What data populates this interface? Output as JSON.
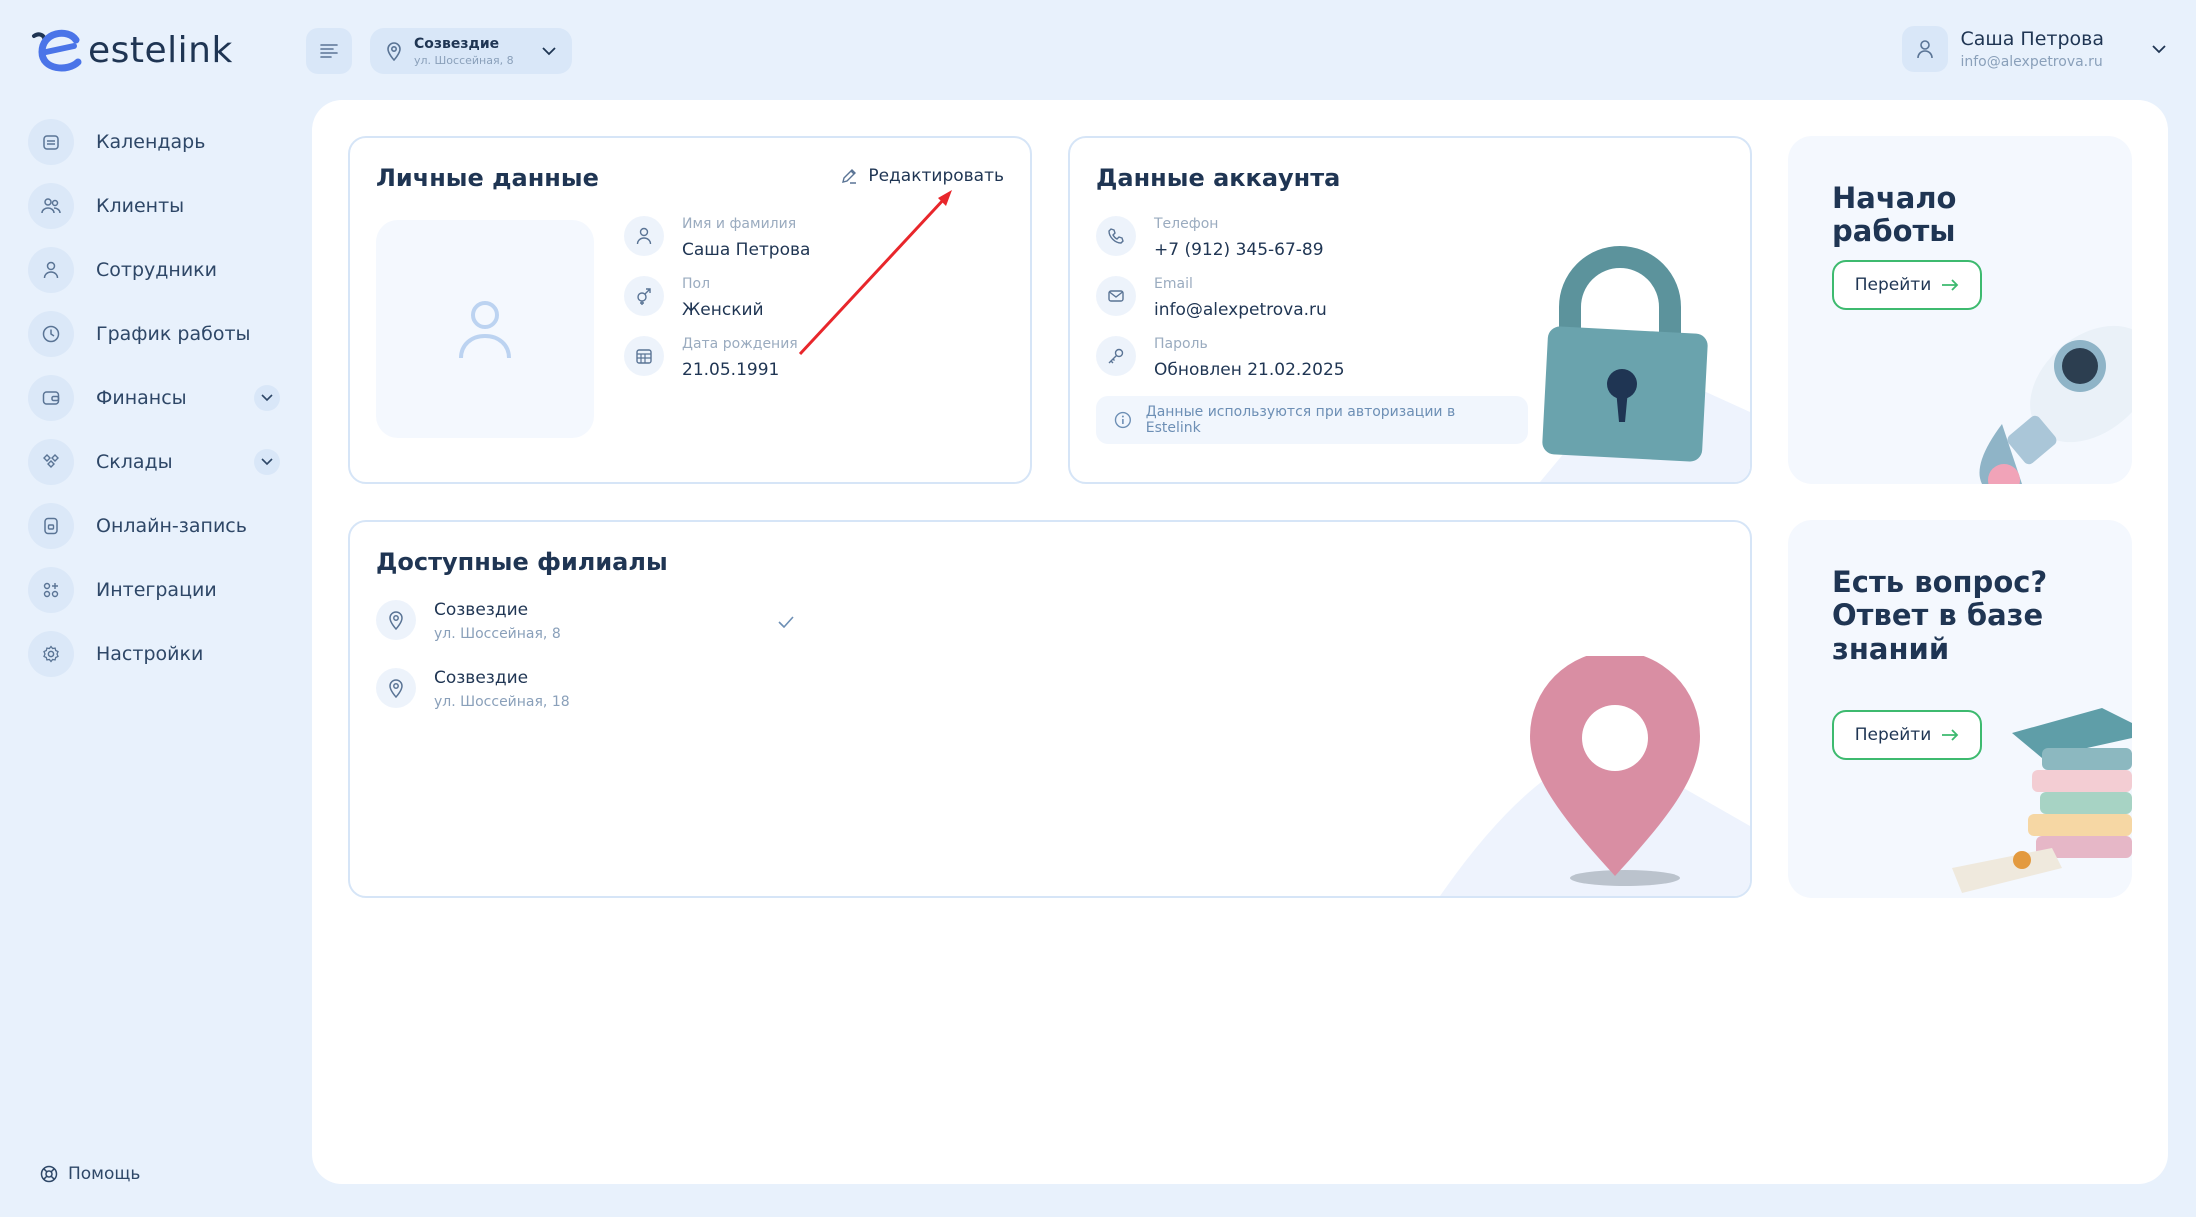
{
  "app": {
    "logo_text": "estelink"
  },
  "header": {
    "branch": {
      "name": "Созвездие",
      "address": "ул. Шоссейная, 8"
    },
    "user": {
      "name": "Саша Петрова",
      "email": "info@alexpetrova.ru"
    }
  },
  "sidebar": {
    "items": [
      {
        "label": "Календарь",
        "icon": "calendar-icon"
      },
      {
        "label": "Клиенты",
        "icon": "clients-icon"
      },
      {
        "label": "Сотрудники",
        "icon": "staff-icon"
      },
      {
        "label": "График работы",
        "icon": "clock-icon"
      },
      {
        "label": "Финансы",
        "icon": "wallet-icon",
        "expandable": true
      },
      {
        "label": "Склады",
        "icon": "warehouse-icon",
        "expandable": true
      },
      {
        "label": "Онлайн-запись",
        "icon": "online-booking-icon"
      },
      {
        "label": "Интеграции",
        "icon": "integrations-icon"
      },
      {
        "label": "Настройки",
        "icon": "gear-icon"
      }
    ],
    "help_label": "Помощь"
  },
  "personal": {
    "title": "Личные данные",
    "edit_label": "Редактировать",
    "fields": [
      {
        "label": "Имя и фамилия",
        "value": "Саша Петрова"
      },
      {
        "label": "Пол",
        "value": "Женский"
      },
      {
        "label": "Дата рождения",
        "value": "21.05.1991"
      }
    ]
  },
  "account": {
    "title": "Данные аккаунта",
    "fields": [
      {
        "label": "Телефон",
        "value": "+7 (912) 345-67-89"
      },
      {
        "label": "Email",
        "value": "info@alexpetrova.ru"
      },
      {
        "label": "Пароль",
        "value": "Обновлен 21.02.2025"
      }
    ],
    "note": "Данные используются при авторизации в Estelink"
  },
  "promo_start": {
    "title": "Начало работы",
    "button": "Перейти"
  },
  "promo_kb": {
    "title": "Есть вопрос? Ответ в базе знаний",
    "button": "Перейти"
  },
  "branches": {
    "title": "Доступные филиалы",
    "items": [
      {
        "name": "Созвездие",
        "address": "ул. Шоссейная, 8",
        "selected": true
      },
      {
        "name": "Созвездие",
        "address": "ул. Шоссейная, 18",
        "selected": false
      }
    ]
  },
  "colors": {
    "accent_green": "#3dba6f",
    "annotation_arrow": "#e8262b",
    "brand_blue": "#4a74e8"
  }
}
